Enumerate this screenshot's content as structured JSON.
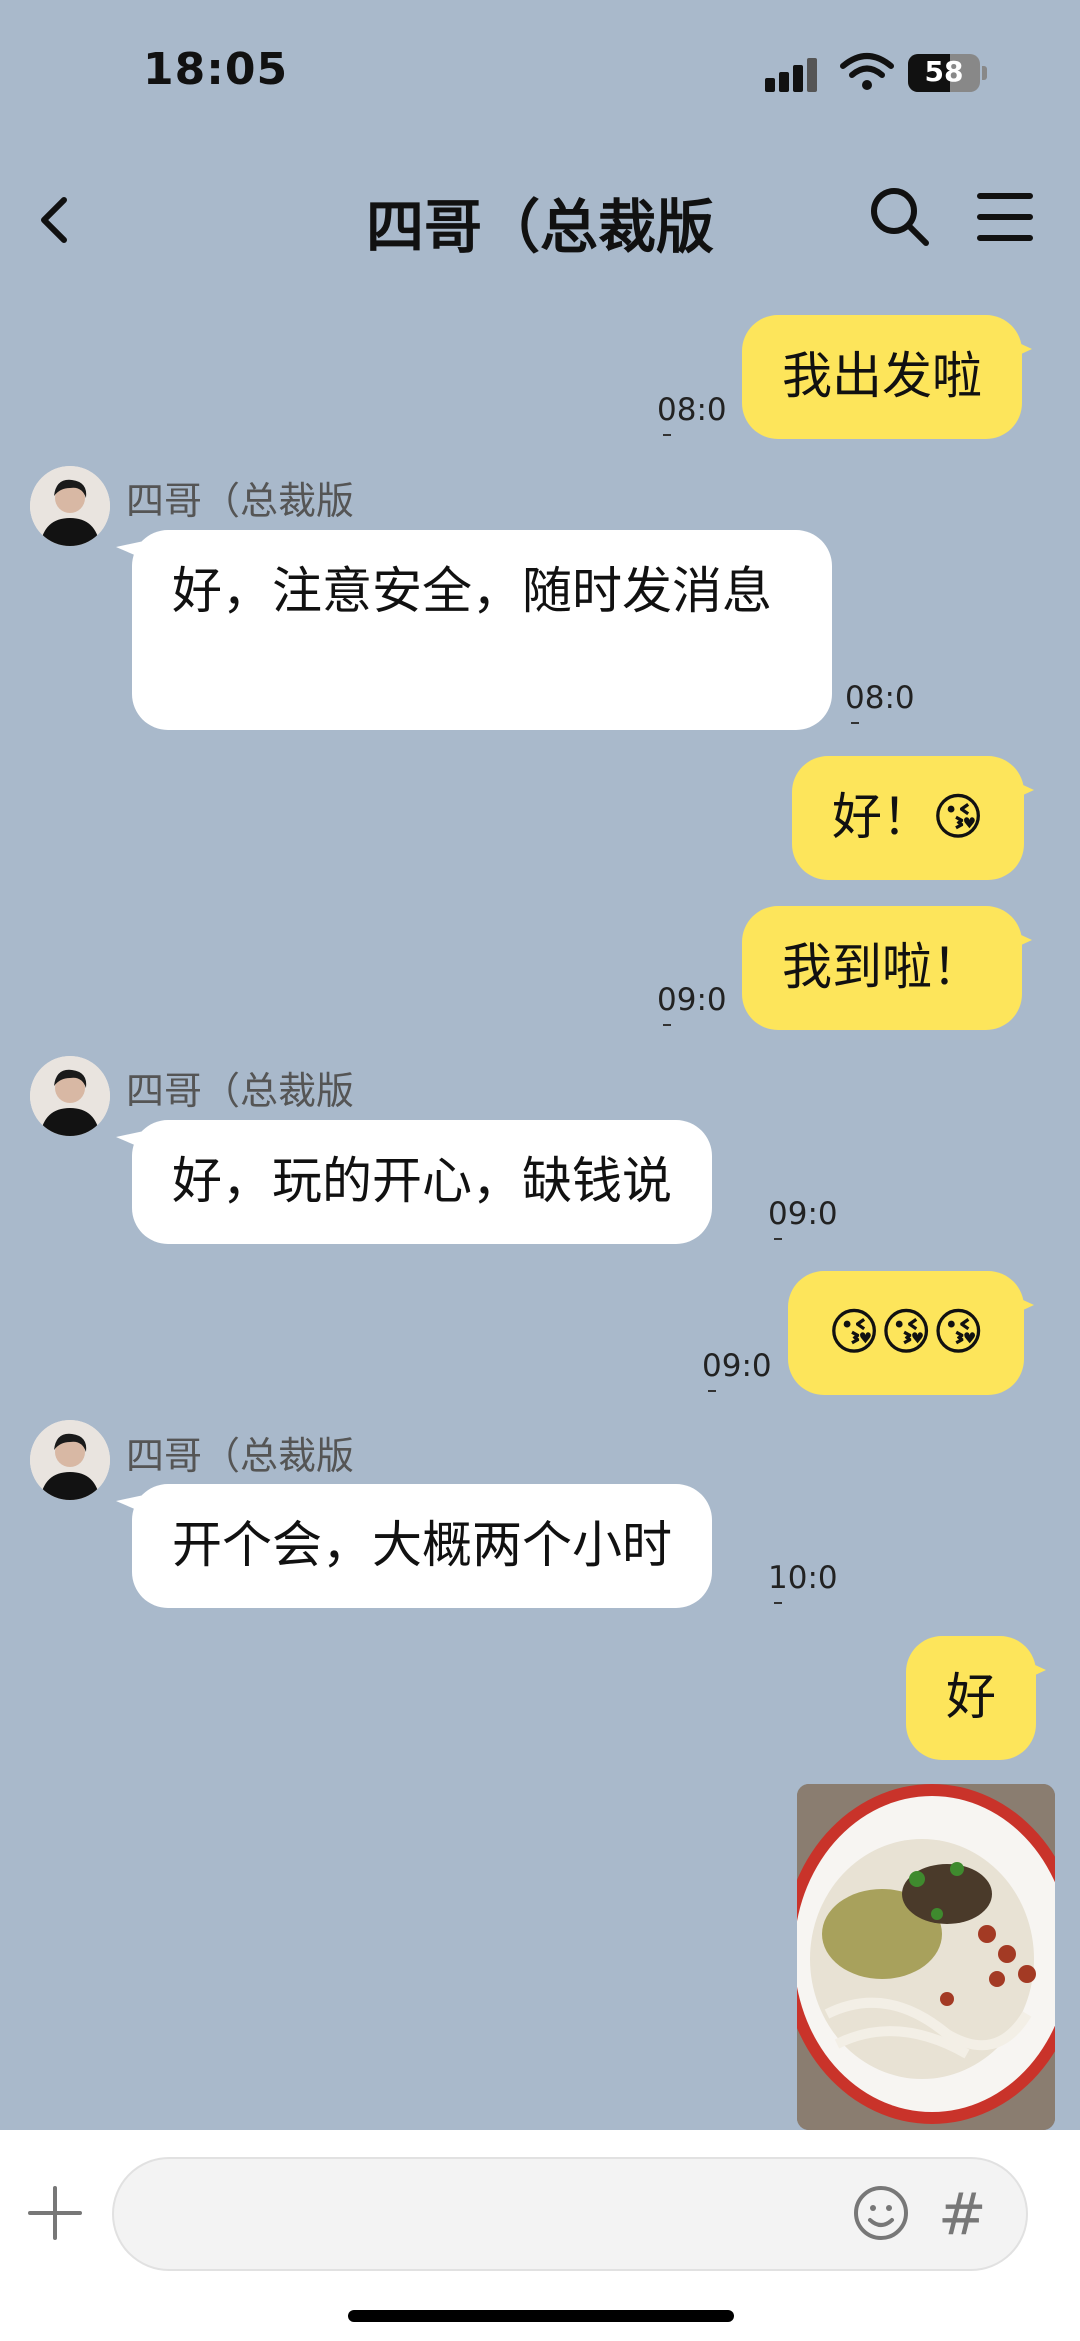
{
  "status_bar": {
    "time": "18:05",
    "battery": "58",
    "battery_level": 0.58
  },
  "header": {
    "title": "四哥（总裁版"
  },
  "messages": [
    {
      "from": "me",
      "text": "我出发啦",
      "time": "08:0"
    },
    {
      "from": "them",
      "sender": "四哥（总裁版",
      "text": "好，注意安全，随时发消息",
      "time": "08:0"
    },
    {
      "from": "me",
      "text": "好！😘"
    },
    {
      "from": "me",
      "text": "我到啦！",
      "time": "09:0"
    },
    {
      "from": "them",
      "sender": "四哥（总裁版",
      "text": "好，玩的开心，缺钱说",
      "time": "09:0"
    },
    {
      "from": "me",
      "text": "😘😘😘",
      "time": "09:0"
    },
    {
      "from": "them",
      "sender": "四哥（总裁版",
      "text": "开个会，大概两个小时",
      "time": "10:0"
    },
    {
      "from": "me",
      "text": "好"
    },
    {
      "from": "me",
      "type": "image"
    }
  ],
  "input": {
    "placeholder": "",
    "hash": "#"
  },
  "icons": [
    "back-icon",
    "search-icon",
    "menu-icon",
    "plus-icon",
    "emoji-icon"
  ]
}
